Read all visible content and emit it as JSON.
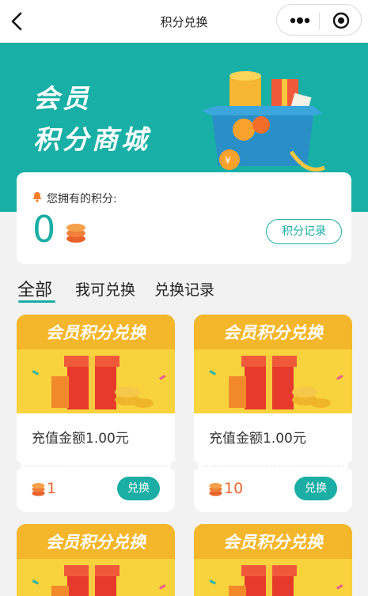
{
  "nav": {
    "title": "积分兑换"
  },
  "banner": {
    "line1": "会员",
    "line2": "积分商城"
  },
  "points": {
    "label": "您拥有的积分:",
    "value": "0",
    "record_label": "积分记录"
  },
  "tabs": [
    {
      "label": "全部",
      "active": true
    },
    {
      "label": "我可兑换",
      "active": false
    },
    {
      "label": "兑换记录",
      "active": false
    }
  ],
  "products": [
    {
      "image_text": "会员积分兑换",
      "name": "充值金额1.00元",
      "price": "1",
      "button": "兑换"
    },
    {
      "image_text": "会员积分兑换",
      "name": "充值金额1.00元",
      "price": "10",
      "button": "兑换"
    },
    {
      "image_text": "会员积分兑换"
    },
    {
      "image_text": "会员积分兑换"
    }
  ],
  "colors": {
    "accent": "#1aaea4",
    "price": "#ee6633",
    "banner": "#18b0a6"
  }
}
